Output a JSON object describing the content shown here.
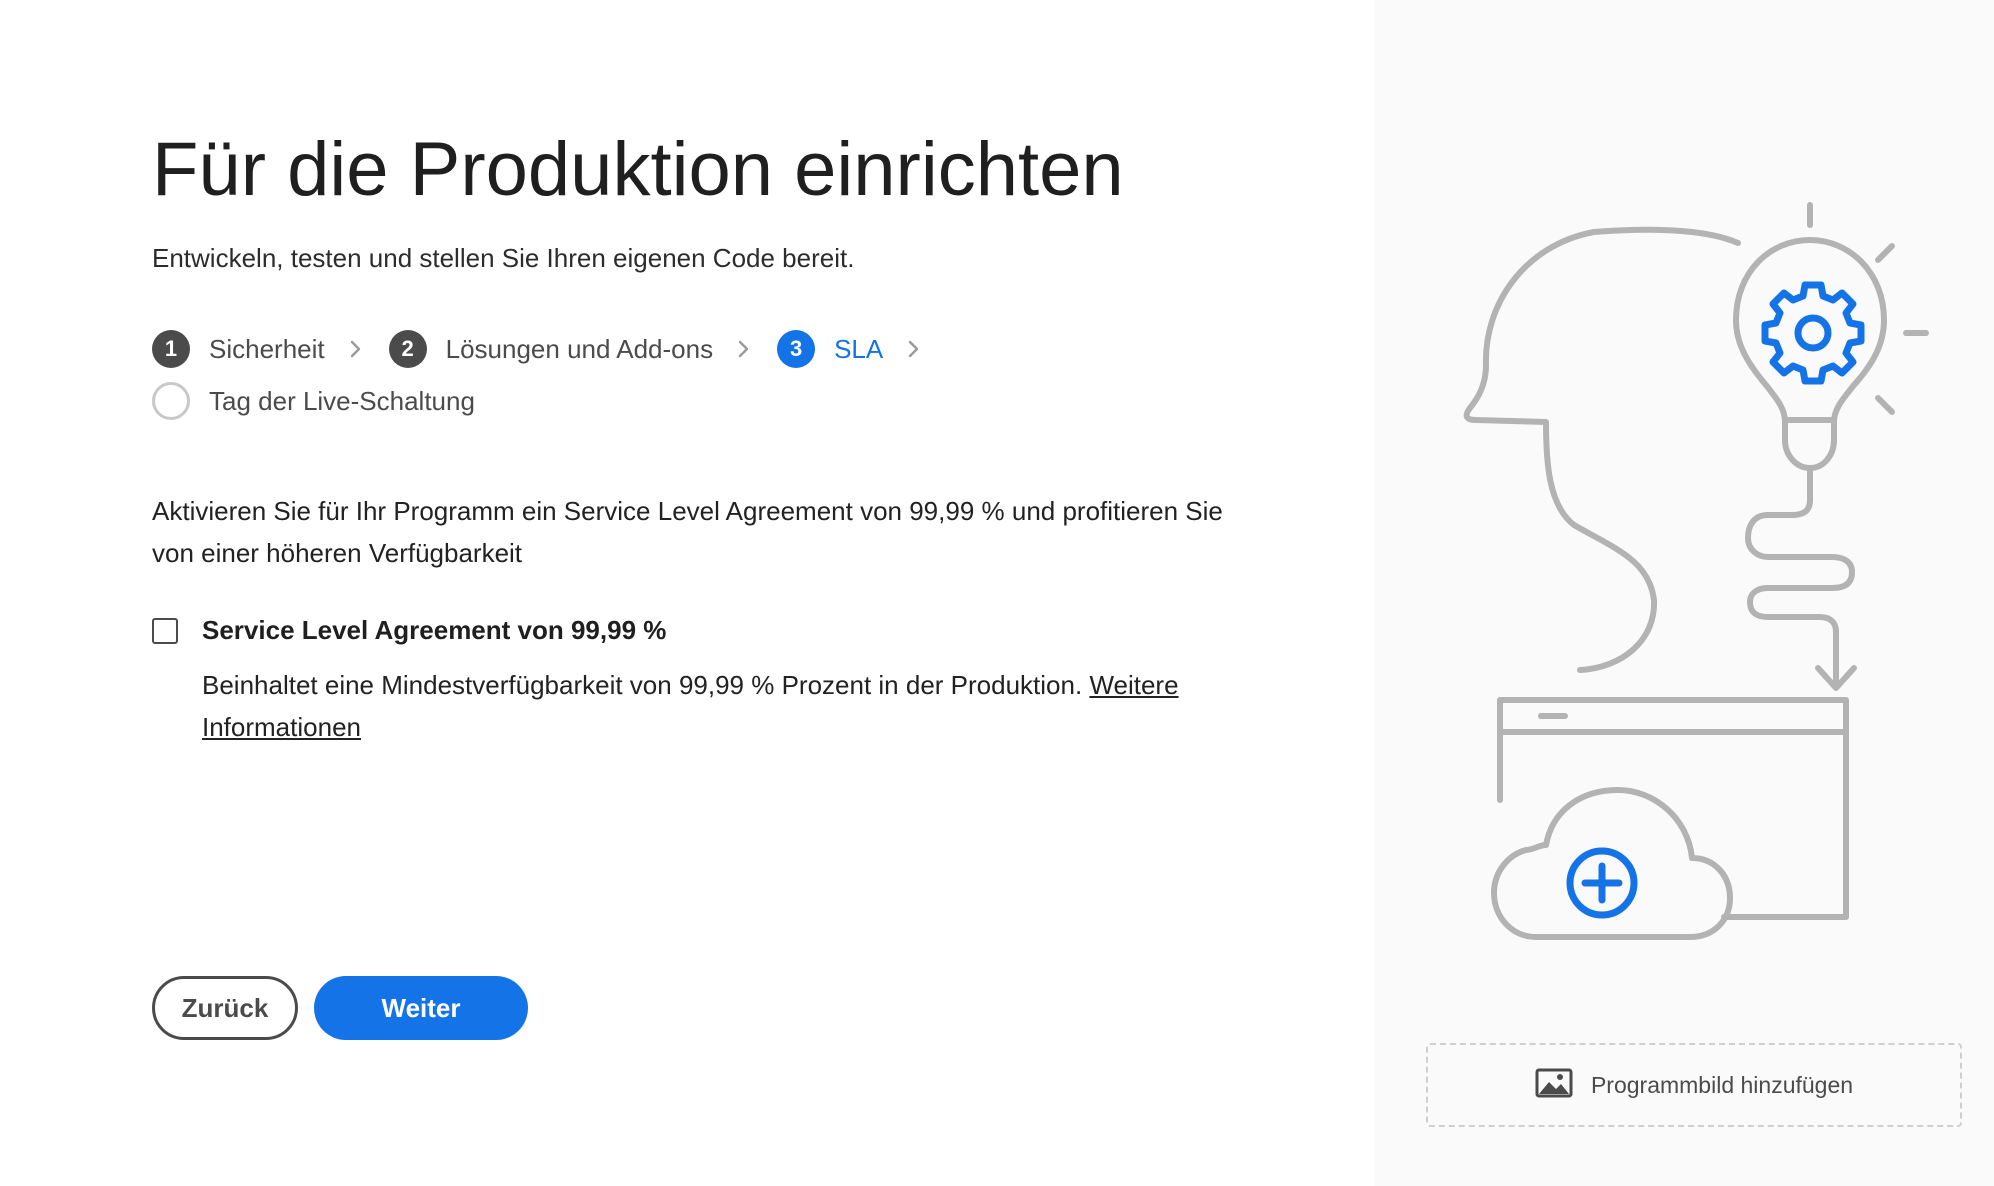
{
  "page": {
    "title": "Für die Produktion einrichten",
    "subtitle": "Entwickeln, testen und stellen Sie Ihren eigenen Code bereit."
  },
  "stepper": {
    "steps": [
      {
        "number": "1",
        "label": "Sicherheit",
        "state": "completed"
      },
      {
        "number": "2",
        "label": "Lösungen und Add-ons",
        "state": "completed"
      },
      {
        "number": "3",
        "label": "SLA",
        "state": "active"
      },
      {
        "number": "",
        "label": "Tag der Live-Schaltung",
        "state": "pending"
      }
    ]
  },
  "sla": {
    "description": "Aktivieren Sie für Ihr Programm ein Service Level Agreement von 99,99 % und profitieren Sie von einer höheren Verfügbarkeit",
    "checkbox_label": "Service Level Agreement von 99,99 %",
    "checked": false,
    "detail_text": "Beinhaltet eine Mindestverfügbarkeit von 99,99 % Prozent in der Produktion.",
    "link_text": "Weitere Informationen"
  },
  "buttons": {
    "back_label": "Zurück",
    "next_label": "Weiter"
  },
  "sidebar": {
    "add_image_label": "Programmbild hinzufügen"
  },
  "colors": {
    "accent": "#1473e6",
    "step_completed": "#4b4b4b",
    "illustration_stroke": "#b3b3b3",
    "sidebar_background": "#fafafa"
  }
}
